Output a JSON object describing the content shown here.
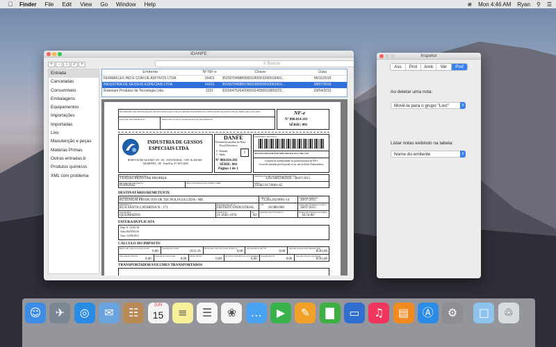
{
  "menubar": {
    "app_name": "Finder",
    "menus": [
      "File",
      "Edit",
      "View",
      "Go",
      "Window",
      "Help"
    ],
    "clock": "Mon 4:46 AM",
    "user": "Ryan"
  },
  "main_window": {
    "title": "iDANFE",
    "toolbar_buttons": [
      "+",
      "-",
      "i",
      "✓",
      "+"
    ],
    "search_placeholder": "Buscar",
    "sidebar_items": [
      "Entrada",
      "Canceladas",
      "Consumíveis",
      "Embalagens",
      "Equipamentos",
      "Importações",
      "Importadas",
      "Lixo",
      "Manutenção e peças",
      "Matérias Primas",
      "Outras entradas.b",
      "Produtos químicos",
      "XML com problema"
    ],
    "table": {
      "headers": [
        "Emitente",
        "Nº NF-e",
        "Chave",
        "Data"
      ],
      "rows": [
        [
          "FERMAFLEX IND E COM DE ADITIVOS LTDA",
          "16401",
          "3515070498890001065501000016401...",
          "06/11/2015"
        ],
        [
          "INDUSTRIA DE GESSOS ESPECIAIS LTDA",
          "14101",
          "2615070408607000165550010001410...",
          "28/07/2015"
        ],
        [
          "Rutenium Produtos de Tecnologia Ltda",
          "2221",
          "3315047526420000114550010000222...",
          "03/04/2015"
        ]
      ]
    }
  },
  "danfe": {
    "receipt_text": "RECEBEMOS DE INDUSTRIA DE GESSOS ESPECIAIS LTDA OS PRODUTOS/SERVIÇOS CONSTANTES DA NOTA FISCAL INDICADA AO LADO",
    "received_date_label": "DATA DE RECEBIMENTO",
    "signature_label": "IDENTIFICAÇÃO E ASSINATURA DO RECEBEDOR",
    "nfe_label": "NF-e",
    "nfe_number": "Nº 000.014.101",
    "series": "SÉRIE: 001",
    "company_name_1": "INDUSTRIA DE GESSOS",
    "company_name_2": "ESPECIAIS LTDA",
    "address": "RODOVIA BR 316 KM27, SN - SN - ZONA RURAL - CEP: 56.280-000 - ARARIPINA - PE - Fone/Fax: 87-3873-2609",
    "danfe_title": "DANFE",
    "danfe_sub_1": "Documento auxiliar da Nota",
    "danfe_sub_2": "Fiscal Eletrônica",
    "entrada": "0 - Entrada",
    "saida": "1 - Saída",
    "tipo": "1",
    "nfe_number_2": "Nº 000.014.101",
    "series_2": "SÉRIE: 001",
    "page": "Página 1 de 1",
    "barcode_label": "CONTROLE DO FISCO",
    "access_key": "2615 0704 0879 0700 0165 5500 1000 0141 0112 7465 7470",
    "consulta_text": "Consulta de autenticidade no portal nacional da NF-e www.nfe.fazenda.gov.br/portal ou no site da Sefaz Autorizadora",
    "natureza_label": "NATUREZA DA OPERAÇÃO",
    "natureza": "VENDAS PROD FAB PROPRIA",
    "protocolo_label": "PROTOCOLO DE AUTORIZAÇÃO DE USO",
    "protocolo": "126150052462950 - 28/07/2015",
    "ie_label": "INSCRIÇÃO ESTADUAL",
    "ie": "014092042",
    "ie_subst_label": "INSC.ESTADUAL DO SUBST. TRIB.",
    "cnpj_label": "CNPJ",
    "cnpj": "24.083.917/0001-65",
    "dest_title": "DESTINATÁRIO/REMETENTE",
    "dest_name_label": "NOME/RAZÃO SOCIAL",
    "dest_name": "RUTENIUM PRODUTOS DE TECNOLOGIA LTDA - ME",
    "dest_cnpj_label": "CNPJ/CPF",
    "dest_cnpj": "73.264.202/0001-14",
    "emissao_label": "DATA DA EMISSÃO",
    "emissao": "28/07/2015",
    "dest_addr_label": "ENDEREÇO",
    "dest_addr": "RUA SANTA CATARINA N.: 171",
    "bairro_label": "BAIRRO/DISTRITO",
    "bairro": "DISTRITO INDUSTRIAL",
    "cep_label": "CEP",
    "cep": "26.980-000",
    "saida_label": "DATA DE ENTRADA/SAÍDA",
    "saida_date": "28/07/2015",
    "municipio_label": "MUNICÍPIO",
    "municipio": "QUEIMADOS",
    "fone_label": "FONE/FAX",
    "fone": "21-2665-1076",
    "uf_label": "UF",
    "uf": "RJ",
    "ie_dest_label": "INSCRIÇÃO ESTADUAL",
    "hora_label": "HORA DE ENTRADA/SAÍDA",
    "hora": "16:56:00",
    "fatura_title": "FATURA/DUPLICATA",
    "fatura_lines": [
      "Dup. Nº 14101/01",
      "Valor R$ 8593,00",
      "Venc. 01/09/2015"
    ],
    "imposto_title": "CÁLCULO DO IMPOSTO",
    "imp_row1": [
      {
        "label": "BASE DE CÁLCULO DO ICMS",
        "value": "0,00"
      },
      {
        "label": "VALOR DO ICMS",
        "value": "1031,16"
      },
      {
        "label": "BASE DE CÁLCULO DO ICMS ST",
        "value": "0,00"
      },
      {
        "label": "VALOR DO ICMS ST",
        "value": "0,00"
      },
      {
        "label": "VALOR TOTAL DOS PRODUTOS",
        "value": "8593,00"
      }
    ],
    "imp_row2": [
      {
        "label": "VALOR DO FRETE",
        "value": "0,00"
      },
      {
        "label": "VALOR DO SEGURO",
        "value": "0,00"
      },
      {
        "label": "DESCONTO",
        "value": "0,00"
      },
      {
        "label": "OUTRAS DESPESAS ACESSÓRIAS",
        "value": "0,00"
      },
      {
        "label": "VALOR DO IPI",
        "value": "0,00"
      },
      {
        "label": "VALOR TOTAL DA NOTA",
        "value": "8593,00"
      }
    ],
    "transp_title": "TRANSPORTADOR/VOLUMES TRANSPORTADOS"
  },
  "inspector": {
    "title": "Inspetor",
    "tabs": [
      "Ass",
      "Prot",
      "Amb",
      "Ver",
      "Pref"
    ],
    "active_tab": "Pref",
    "delete_label": "Ao deletar uma nota:",
    "delete_value": "Movê-la para o grupo \"Lixo\"",
    "list_label": "Listar notas exibindo na tabela:",
    "list_value": "Nome do emitente"
  },
  "dock_items": [
    {
      "name": "finder",
      "color": "#3d8de6"
    },
    {
      "name": "launchpad",
      "color": "#7d8793"
    },
    {
      "name": "safari",
      "color": "#2a8be4"
    },
    {
      "name": "mail",
      "color": "#6aa3de"
    },
    {
      "name": "contacts",
      "color": "#b98a55"
    },
    {
      "name": "calendar",
      "color": "#f4f4f4"
    },
    {
      "name": "notes",
      "color": "#f7ef9a"
    },
    {
      "name": "reminders",
      "color": "#f6f6f6"
    },
    {
      "name": "photos",
      "color": "#f4f4f4"
    },
    {
      "name": "messages",
      "color": "#4aa3f0"
    },
    {
      "name": "facetime",
      "color": "#38b24a"
    },
    {
      "name": "pages",
      "color": "#f1a12a"
    },
    {
      "name": "numbers",
      "color": "#3eb043"
    },
    {
      "name": "keynote",
      "color": "#2f6fd0"
    },
    {
      "name": "itunes",
      "color": "#f0365c"
    },
    {
      "name": "ibooks",
      "color": "#f28a1e"
    },
    {
      "name": "app-store",
      "color": "#2a8ce6"
    },
    {
      "name": "system-preferences",
      "color": "#8d8d92"
    },
    {
      "name": "folder",
      "color": "#8ec3ee"
    },
    {
      "name": "trash",
      "color": "#d8dbe0"
    }
  ],
  "calendar_icon": {
    "month": "JUN",
    "day": "15"
  }
}
